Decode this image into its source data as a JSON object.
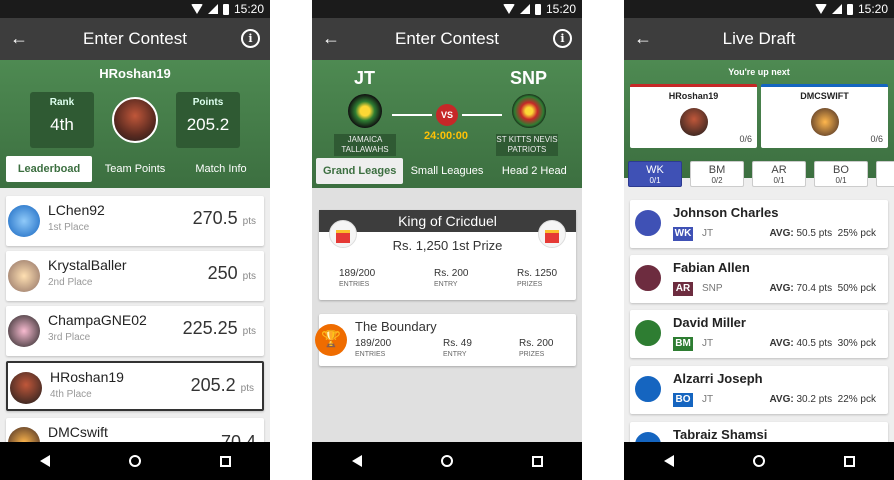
{
  "status": {
    "time": "15:20"
  },
  "screen1": {
    "title": "Enter Contest",
    "username": "HRoshan19",
    "rank_label": "Rank",
    "rank_value": "4th",
    "points_label": "Points",
    "points_value": "205.2",
    "tabs": [
      "Leaderboad",
      "Team  Points",
      "Match Info"
    ],
    "leaderboard": [
      {
        "name": "LChen92",
        "place": "1st Place",
        "score": "270.5",
        "unit": "pts"
      },
      {
        "name": "KrystalBaller",
        "place": "2nd Place",
        "score": "250",
        "unit": "pts"
      },
      {
        "name": "ChampaGNE02",
        "place": "3rd Place",
        "score": "225.25",
        "unit": "pts"
      },
      {
        "name": "HRoshan19",
        "place": "4th Place",
        "score": "205.2",
        "unit": "pts"
      },
      {
        "name": "DMCswift",
        "place": "",
        "score": "70.4",
        "unit": ""
      }
    ]
  },
  "screen2": {
    "title": "Enter Contest",
    "team1_code": "JT",
    "team2_code": "SNP",
    "team1_name": "JAMAICA TALLAWAHS",
    "team2_name": "ST KITTS NEVIS PATRIOTS",
    "vs": "VS",
    "timer": "24:00:00",
    "tabs": [
      "Grand Leages",
      "Small Leagues",
      "Head 2 Head"
    ],
    "contest1": {
      "name": "King of Cricduel",
      "prize": "Rs. 1,250 1st Prize",
      "entries": "189/200",
      "entries_label": "ENTRIES",
      "entry": "Rs. 200",
      "entry_label": "ENTRY",
      "prizes": "Rs. 1250",
      "prizes_label": "PRIZES"
    },
    "contest2": {
      "name": "The Boundary",
      "entries": "189/200",
      "entries_label": "ENTRIES",
      "entry": "Rs. 49",
      "entry_label": "ENTRY",
      "prizes": "Rs. 200",
      "prizes_label": "PRIZES"
    }
  },
  "screen3": {
    "title": "Live Draft",
    "turn_message": "You're up next",
    "drafters": [
      {
        "name": "HRoshan19",
        "count": "0/6"
      },
      {
        "name": "DMCSWIFT",
        "count": "0/6"
      }
    ],
    "positions": [
      {
        "code": "WK",
        "count": "0/1"
      },
      {
        "code": "BM",
        "count": "0/2"
      },
      {
        "code": "AR",
        "count": "0/1"
      },
      {
        "code": "BO",
        "count": "0/1"
      }
    ],
    "players": [
      {
        "name": "Johnson Charles",
        "pos": "WK",
        "team": "JT",
        "avg_label": "AVG:",
        "avg": "50.5 pts",
        "pick": "25% pck"
      },
      {
        "name": "Fabian Allen",
        "pos": "AR",
        "team": "SNP",
        "avg_label": "AVG:",
        "avg": "70.4 pts",
        "pick": "50% pck"
      },
      {
        "name": "David Miller",
        "pos": "BM",
        "team": "JT",
        "avg_label": "AVG:",
        "avg": "40.5 pts",
        "pick": "30% pck"
      },
      {
        "name": "Alzarri Joseph",
        "pos": "BO",
        "team": "JT",
        "avg_label": "AVG:",
        "avg": "30.2 pts",
        "pick": "22% pck"
      },
      {
        "name": "Tabraiz Shamsi"
      }
    ]
  },
  "colors": {
    "green": "#3c6f40",
    "appbar": "#3d3d3d",
    "red": "#c62828",
    "indigo": "#3f51b5"
  }
}
